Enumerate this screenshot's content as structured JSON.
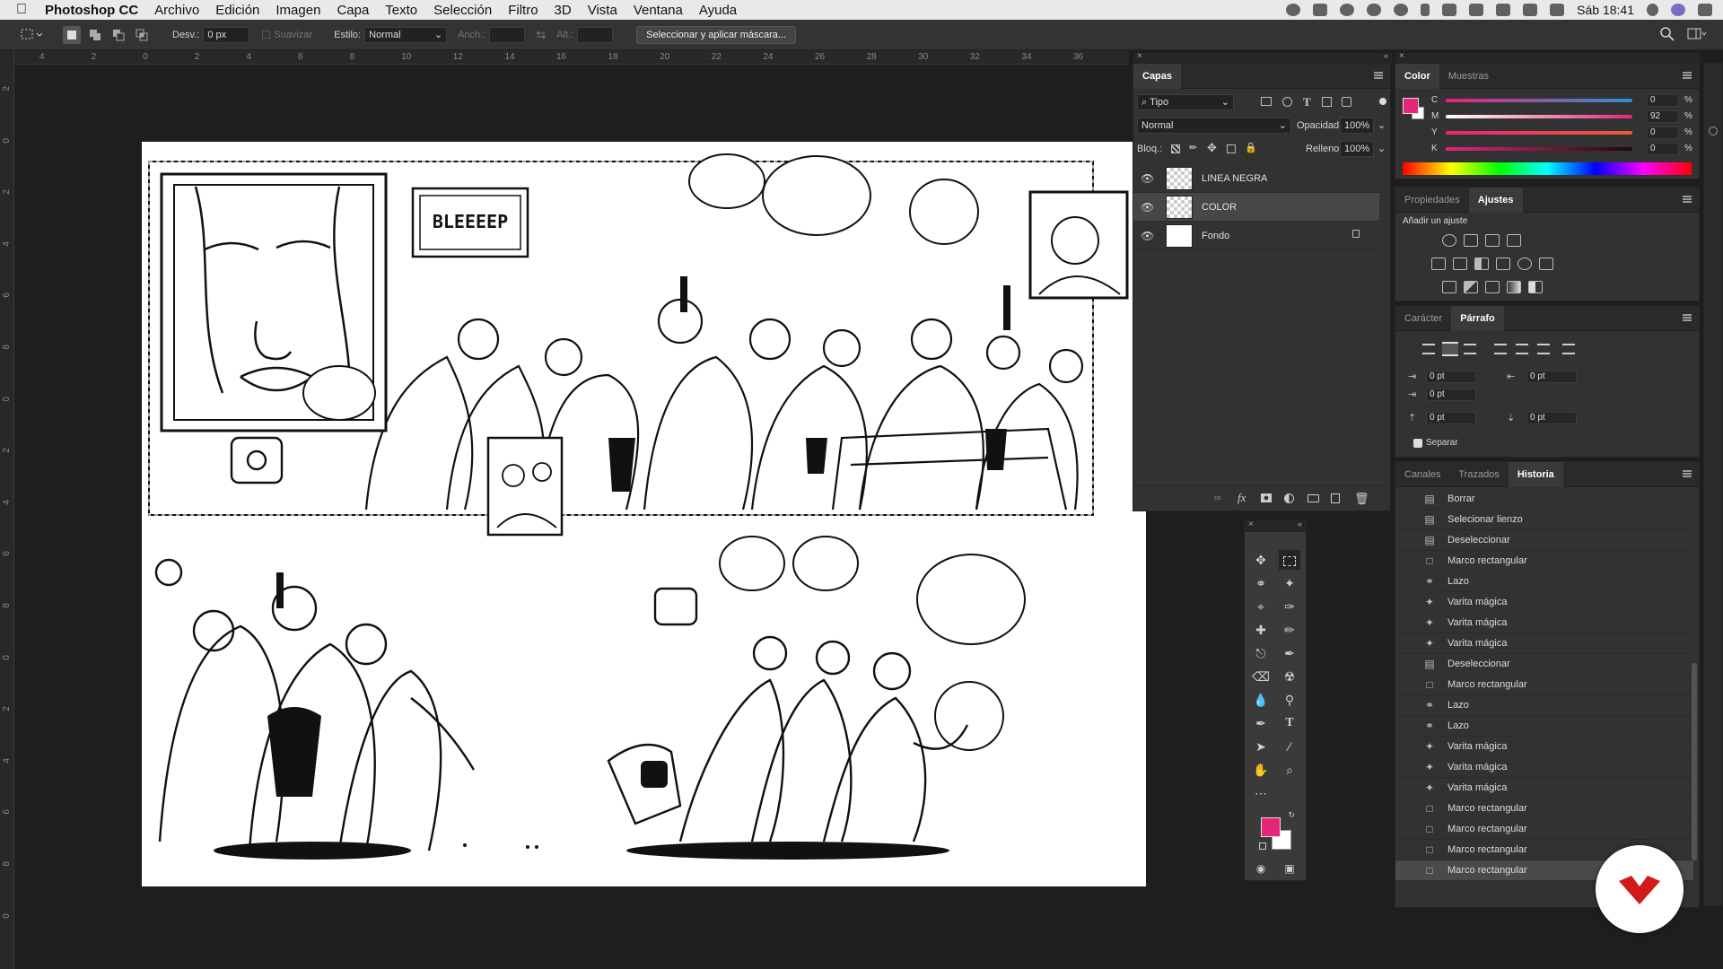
{
  "menubar": {
    "app": "Photoshop CC",
    "items": [
      "Archivo",
      "Edición",
      "Imagen",
      "Capa",
      "Texto",
      "Selección",
      "Filtro",
      "3D",
      "Vista",
      "Ventana",
      "Ayuda"
    ],
    "clock": "Sáb 18:41"
  },
  "options": {
    "feather_label": "Desv.:",
    "feather_value": "0 px",
    "antialias_label": "Suavizar",
    "style_label": "Estilo:",
    "style_value": "Normal",
    "width_label": "Anch.:",
    "height_label": "Alt.:",
    "mask_button": "Seleccionar y aplicar máscara..."
  },
  "ruler": {
    "h_ticks": [
      "4",
      "2",
      "0",
      "2",
      "4",
      "6",
      "8",
      "10",
      "12",
      "14",
      "16",
      "18",
      "20",
      "22",
      "24",
      "26",
      "28",
      "30",
      "32",
      "34",
      "36"
    ],
    "v_ticks": [
      "2",
      "0",
      "2",
      "4",
      "6",
      "8",
      "0",
      "2",
      "4",
      "6",
      "8",
      "0",
      "2",
      "4",
      "6",
      "8",
      "0"
    ]
  },
  "canvas": {
    "bubble_text": "BLEEEEP"
  },
  "layers_panel": {
    "tab": "Capas",
    "filter": "Tipo",
    "blend_mode": "Normal",
    "opacity_label": "Opacidad:",
    "opacity_value": "100%",
    "lock_label": "Bloq.:",
    "fill_label": "Relleno:",
    "fill_value": "100%",
    "layers": [
      {
        "name": "LINEA NEGRA"
      },
      {
        "name": "COLOR"
      },
      {
        "name": "Fondo"
      }
    ]
  },
  "color_panel": {
    "tabs": [
      "Color",
      "Muestras"
    ],
    "channels": [
      {
        "label": "C",
        "value": "0"
      },
      {
        "label": "M",
        "value": "92"
      },
      {
        "label": "Y",
        "value": "0"
      },
      {
        "label": "K",
        "value": "0"
      }
    ],
    "unit": "%",
    "foreground": "#e4267a",
    "background": "#ffffff"
  },
  "props_panel": {
    "tabs": [
      "Propiedades",
      "Ajustes"
    ],
    "add_adjustment": "Añadir un ajuste"
  },
  "para_panel": {
    "tabs": [
      "Carácter",
      "Párrafo"
    ],
    "fields": [
      "0 pt",
      "0 pt",
      "0 pt",
      "0 pt",
      "0 pt"
    ],
    "hyphenate": "Separar"
  },
  "history_panel": {
    "tabs": [
      "Canales",
      "Trazados",
      "Historia"
    ],
    "steps": [
      {
        "icon": "doc",
        "label": "Borrar"
      },
      {
        "icon": "doc",
        "label": "Selecionar lienzo"
      },
      {
        "icon": "doc",
        "label": "Deseleccionar"
      },
      {
        "icon": "marquee",
        "label": "Marco rectangular"
      },
      {
        "icon": "lasso",
        "label": "Lazo"
      },
      {
        "icon": "wand",
        "label": "Varita mágica"
      },
      {
        "icon": "wand",
        "label": "Varita mágica"
      },
      {
        "icon": "wand",
        "label": "Varita mágica"
      },
      {
        "icon": "doc",
        "label": "Deseleccionar"
      },
      {
        "icon": "marquee",
        "label": "Marco rectangular"
      },
      {
        "icon": "lasso",
        "label": "Lazo"
      },
      {
        "icon": "lasso",
        "label": "Lazo"
      },
      {
        "icon": "wand",
        "label": "Varita mágica"
      },
      {
        "icon": "wand",
        "label": "Varita mágica"
      },
      {
        "icon": "wand",
        "label": "Varita mágica"
      },
      {
        "icon": "marquee",
        "label": "Marco rectangular"
      },
      {
        "icon": "marquee",
        "label": "Marco rectangular"
      },
      {
        "icon": "marquee",
        "label": "Marco rectangular"
      },
      {
        "icon": "marquee",
        "label": "Marco rectangular"
      }
    ]
  },
  "colors": {
    "accent_pink": "#e4267a",
    "logo_red": "#d11a1a"
  }
}
